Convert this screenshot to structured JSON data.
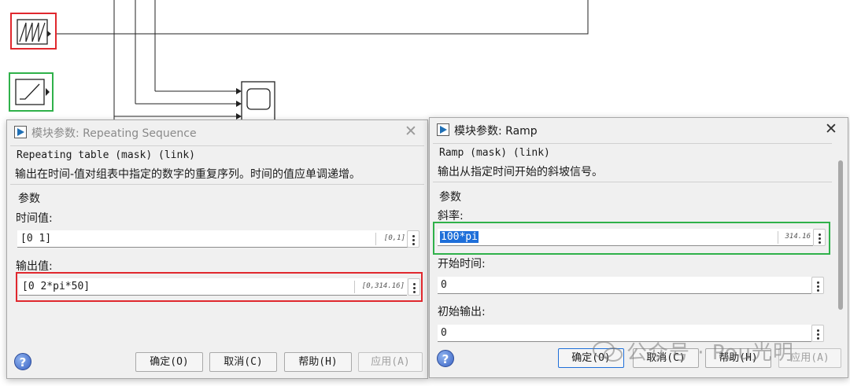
{
  "dialog_repeating": {
    "title": "模块参数: Repeating Sequence",
    "mask_line": "Repeating table (mask) (link)",
    "description": "输出在时间-值对组表中指定的数字的重复序列。时间的值应单调递增。",
    "group_title": "参数",
    "time_label": "时间值:",
    "time_value": "[0 1]",
    "time_eval": "[0,1]",
    "output_label": "输出值:",
    "output_value": "[0 2*pi*50]",
    "output_eval": "[0,314.16]",
    "buttons": {
      "ok": "确定(O)",
      "cancel": "取消(C)",
      "help": "帮助(H)",
      "apply": "应用(A)"
    }
  },
  "dialog_ramp": {
    "title": "模块参数: Ramp",
    "mask_line": "Ramp (mask) (link)",
    "description": "输出从指定时间开始的斜坡信号。",
    "group_title": "参数",
    "slope_label": "斜率:",
    "slope_value": "100*pi",
    "slope_eval": "314.16",
    "start_label": "开始时间:",
    "start_value": "0",
    "initial_label": "初始输出:",
    "initial_value": "0",
    "buttons": {
      "ok": "确定(O)",
      "cancel": "取消(C)",
      "help": "帮助(H)",
      "apply": "应用(A)"
    }
  },
  "icons": {
    "help": "question-mark-icon",
    "close": "close-icon",
    "dialog": "simulink-block-icon",
    "repeating_block": "repeating-sequence-block",
    "ramp_block": "ramp-block",
    "scope_block": "scope-block"
  },
  "watermark": "公众号 · Pou光明",
  "colors": {
    "highlight_red": "#e0282e",
    "highlight_green": "#2fb14a",
    "selection": "#1e6fd9"
  }
}
